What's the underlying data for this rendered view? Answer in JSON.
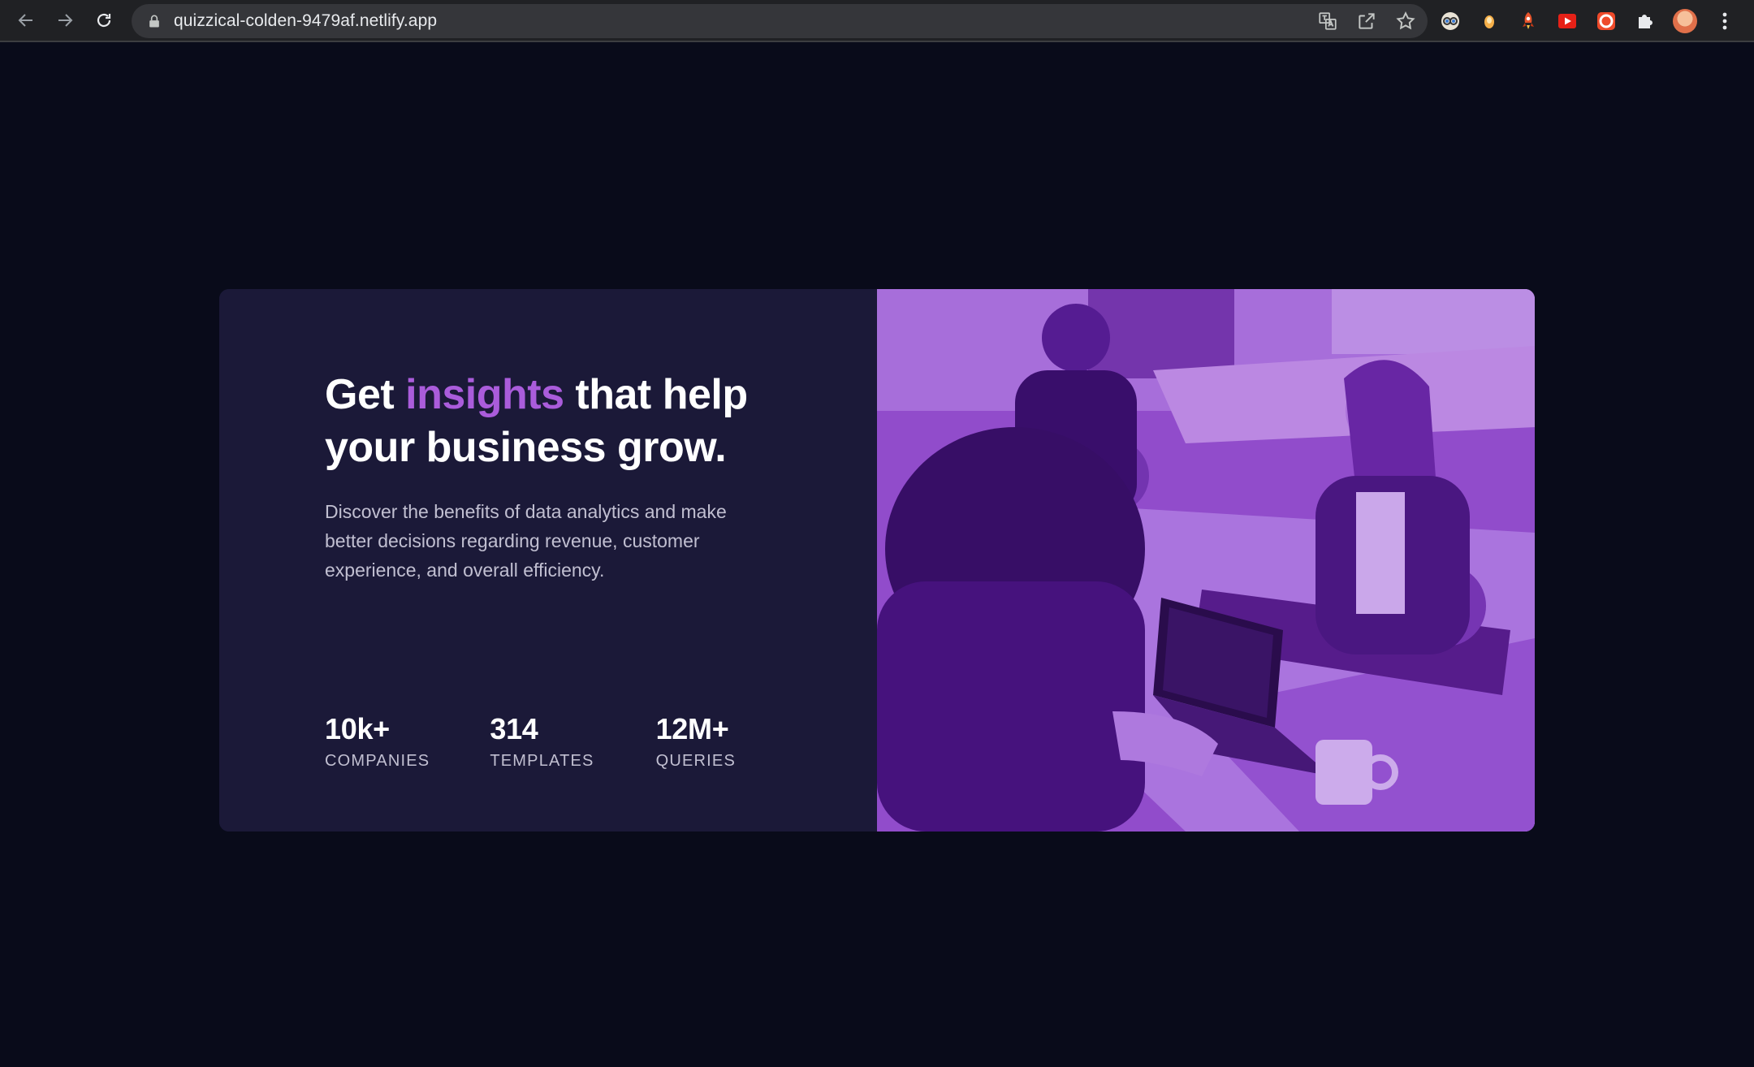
{
  "browser": {
    "url": "quizzical-colden-9479af.netlify.app",
    "icons": {
      "back": "arrow-left-icon",
      "forward": "arrow-right-icon",
      "reload": "reload-icon",
      "lock": "lock-icon",
      "translate": "translate-icon",
      "share": "share-icon",
      "bookmark": "star-icon",
      "extensions": [
        "glasses-extension-icon",
        "candle-extension-icon",
        "rocket-extension-icon",
        "youtube-extension-icon",
        "lifebuoy-extension-icon",
        "puzzle-icon"
      ],
      "menu": "kebab-menu-icon"
    }
  },
  "hero": {
    "headline_before": "Get ",
    "headline_accent": "insights",
    "headline_after": " that help your business grow.",
    "description": "Discover the benefits of data analytics and make better decisions regarding revenue, customer experience, and overall efficiency.",
    "stats": [
      {
        "value": "10k+",
        "label": "COMPANIES"
      },
      {
        "value": "314",
        "label": "TEMPLATES"
      },
      {
        "value": "12M+",
        "label": "QUERIES"
      }
    ],
    "image_alt": "People working at a table with laptops, tinted purple",
    "colors": {
      "page_bg": "#090b1a",
      "card_bg": "#1b1938",
      "accent": "#aa5cdb",
      "text_muted": "#c1bfd1"
    }
  }
}
